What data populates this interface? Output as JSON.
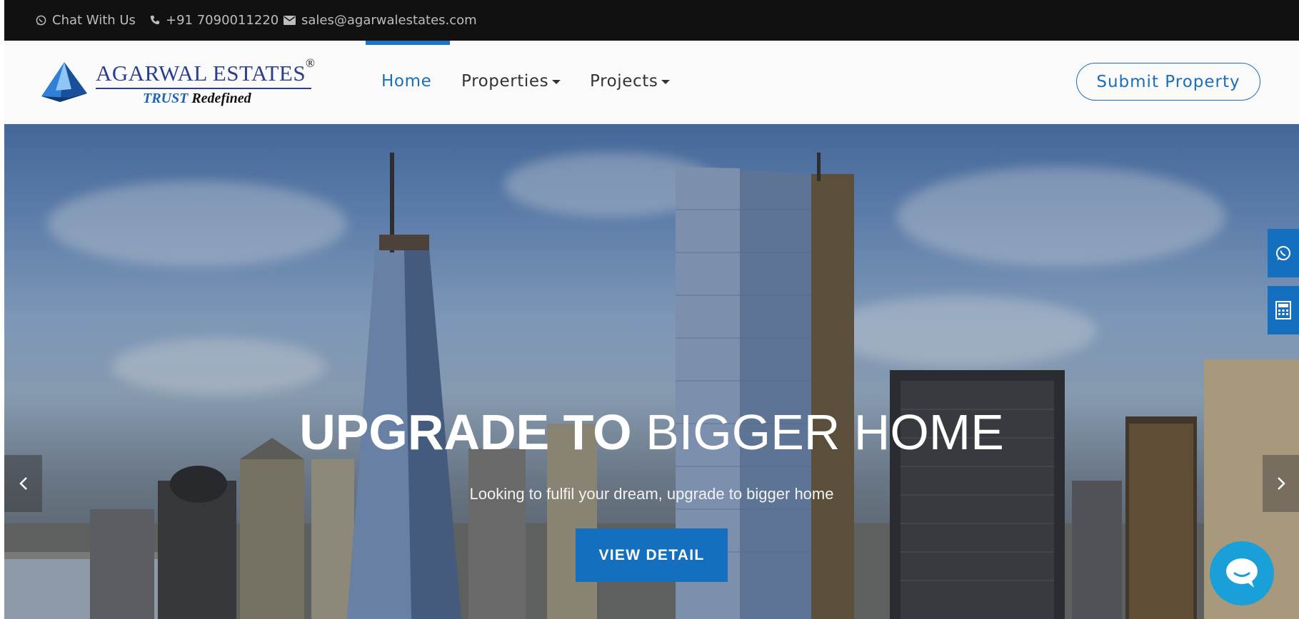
{
  "topbar": {
    "chat_label": "Chat With Us",
    "phone": "+91 7090011220",
    "email": "sales@agarwalestates.com"
  },
  "logo": {
    "title": "AGARWAL ESTATES",
    "registered": "®",
    "tagline_part1": "TRUST",
    "tagline_part2": "Redefined"
  },
  "nav": {
    "items": [
      {
        "label": "Home",
        "active": true
      },
      {
        "label": "Properties",
        "dropdown": true
      },
      {
        "label": "Projects",
        "dropdown": true
      }
    ],
    "submit_label": "Submit Property"
  },
  "hero": {
    "title_bold": "UPGRADE TO",
    "title_light": "BIGGER HOME",
    "subtitle": "Looking to fulfil your dream, upgrade to bigger home",
    "button_label": "VIEW DETAIL"
  },
  "colors": {
    "accent": "#1470bf",
    "topbar_bg": "#111111",
    "header_bg": "#fafafa"
  },
  "icons": {
    "topbar": [
      "whatsapp-icon",
      "phone-icon",
      "envelope-icon"
    ],
    "side": [
      "whatsapp-icon",
      "calculator-icon"
    ],
    "chat": "chat-bubble-icon",
    "slider": [
      "chevron-left-icon",
      "chevron-right-icon"
    ]
  }
}
